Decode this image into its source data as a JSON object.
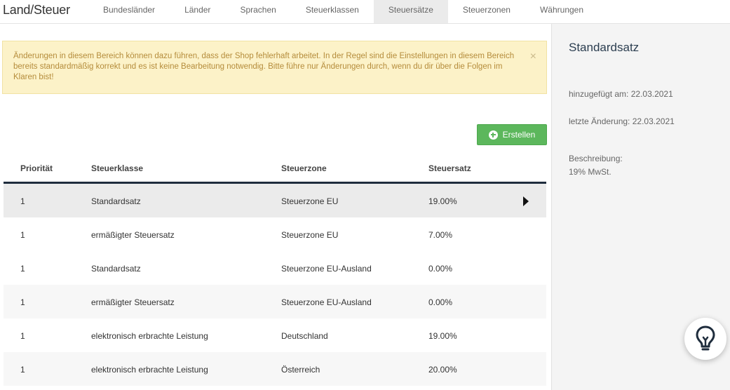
{
  "header": {
    "title": "Land/Steuer",
    "tabs": [
      {
        "label": "Bundesländer"
      },
      {
        "label": "Länder"
      },
      {
        "label": "Sprachen"
      },
      {
        "label": "Steuerklassen"
      },
      {
        "label": "Steuersätze",
        "active": true
      },
      {
        "label": "Steuerzonen"
      },
      {
        "label": "Währungen"
      }
    ]
  },
  "alert": {
    "text": "Änderungen in diesem Bereich können dazu führen, dass der Shop fehlerhaft arbeitet. In der Regel sind die Einstellungen in diesem Bereich bereits standardmäßig korrekt und es ist keine Bearbeitung notwendig. Bitte führe nur Änderungen durch, wenn du dir über die Folgen im Klaren bist!",
    "close": "×"
  },
  "toolbar": {
    "create_label": "Erstellen",
    "create_icon": "plus-circle-icon"
  },
  "table": {
    "columns": [
      "Priorität",
      "Steuerklasse",
      "Steuerzone",
      "Steuersatz"
    ],
    "rows": [
      {
        "priority": "1",
        "class": "Standardsatz",
        "zone": "Steuerzone EU",
        "rate": "19.00%"
      },
      {
        "priority": "1",
        "class": "ermäßigter Steuersatz",
        "zone": "Steuerzone EU",
        "rate": "7.00%"
      },
      {
        "priority": "1",
        "class": "Standardsatz",
        "zone": "Steuerzone EU-Ausland",
        "rate": "0.00%"
      },
      {
        "priority": "1",
        "class": "ermäßigter Steuersatz",
        "zone": "Steuerzone EU-Ausland",
        "rate": "0.00%"
      },
      {
        "priority": "1",
        "class": "elektronisch erbrachte Leistung",
        "zone": "Deutschland",
        "rate": "19.00%"
      },
      {
        "priority": "1",
        "class": "elektronisch erbrachte Leistung",
        "zone": "Österreich",
        "rate": "20.00%"
      }
    ]
  },
  "side": {
    "title": "Standardsatz",
    "added": "hinzugefügt am: 22.03.2021",
    "modified": "letzte Änderung: 22.03.2021",
    "description_label": "Beschreibung:",
    "description": "19% MwSt."
  },
  "colors": {
    "accent": "#5cb75c",
    "alert_bg": "#fcf2c8",
    "header_border": "#1f2d3d"
  }
}
